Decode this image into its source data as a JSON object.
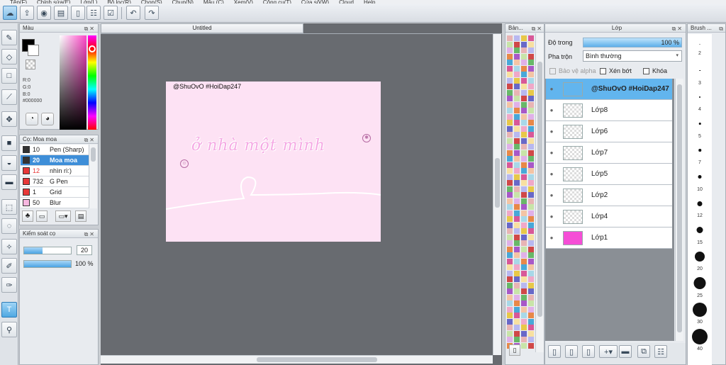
{
  "menu": [
    "Tệp(F)",
    "Chỉnh sửa(E)",
    "Lớp(L)",
    "Bộ lọc(R)",
    "Chọn(S)",
    "Chụp(N)",
    "Mẫu (C)",
    "Xem(V)",
    "Công cụ(T)",
    "Cửa sổ(W)",
    "Cloud",
    "Help"
  ],
  "canvas": {
    "tab_title": "Untitled",
    "watermark": "@ShuOvO #HoiDap247",
    "artwork_text": "ở nhà một mình"
  },
  "color_panel": {
    "title": "Màu",
    "r_label": "R:0",
    "g_label": "G:0",
    "b_label": "B:0",
    "hex": "#000000",
    "fg_color": "#000000",
    "bg_color": "#ffffff"
  },
  "brush_panel": {
    "title": "Cọ: Moa moa",
    "items": [
      {
        "size": "10",
        "name": "Pen (Sharp)",
        "color": "#333333"
      },
      {
        "size": "20",
        "name": "Moa moa",
        "color": "#333333"
      },
      {
        "size": "12",
        "name": "nhìn rì:)",
        "color": "#e83838"
      },
      {
        "size": "732",
        "name": "G Pen",
        "color": "#e83838"
      },
      {
        "size": "1",
        "name": "Grid",
        "color": "#e83838"
      },
      {
        "size": "50",
        "name": "Blur",
        "color": "#f7b7e0"
      }
    ]
  },
  "control_panel": {
    "title": "Kiểm soát cọ",
    "size_value": "20",
    "opacity_value": "100 %",
    "size_fraction": 0.4,
    "opacity_fraction": 1.0
  },
  "palette_panel": {
    "title": "Bản..."
  },
  "layer_panel": {
    "title": "Lớp",
    "opacity_label": "Độ trong",
    "opacity_value": "100 %",
    "blend_label": "Pha trộn",
    "blend_value": "Bình thường",
    "protect_alpha": "Bảo vệ alpha",
    "clipping": "Xén bớt",
    "lock": "Khóa",
    "layers": [
      {
        "name": "@ShuOvO #HoiDap247",
        "thumb_color": "#62b5ee"
      },
      {
        "name": "Lớp8",
        "thumb_color": ""
      },
      {
        "name": "Lớp6",
        "thumb_color": ""
      },
      {
        "name": "Lớp7",
        "thumb_color": ""
      },
      {
        "name": "Lớp5",
        "thumb_color": ""
      },
      {
        "name": "Lớp2",
        "thumb_color": ""
      },
      {
        "name": "Lớp4",
        "thumb_color": ""
      },
      {
        "name": "Lớp1",
        "thumb_color": "#f54ed6"
      }
    ]
  },
  "brush_size_panel": {
    "title": "Brush ...",
    "sizes": [
      "2",
      "3",
      "4",
      "5",
      "7",
      "10",
      "12",
      "15",
      "20",
      "25",
      "30",
      "40"
    ]
  },
  "colors": {
    "accent": "#3e8ed8",
    "canvas_bg": "#686b70",
    "artwork_pink": "#fde0f3",
    "artwork_text": "#f7b3e8"
  }
}
